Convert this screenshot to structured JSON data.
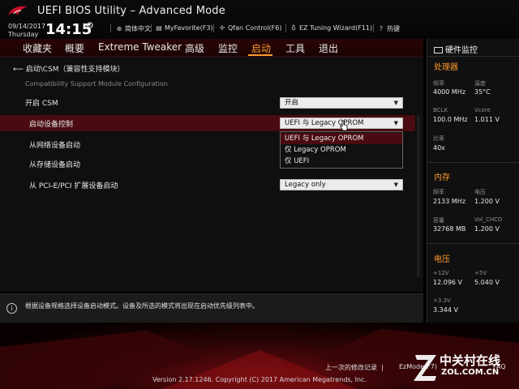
{
  "header": {
    "title": "UEFI BIOS Utility – Advanced Mode",
    "date": "09/14/2017",
    "weekday": "Thursday",
    "time": "14:15",
    "tools": [
      {
        "icon": "globe-icon",
        "label": "简体中文"
      },
      {
        "icon": "myfavorite-icon",
        "label": "MyFavorite(F3)"
      },
      {
        "icon": "fan-icon",
        "label": "Qfan Control(F6)"
      },
      {
        "icon": "bulb-icon",
        "label": "EZ Tuning Wizard(F11)"
      },
      {
        "icon": "hotkey-icon",
        "label": "热键"
      }
    ]
  },
  "menu": {
    "items": [
      "收藏夹",
      "概要",
      "Extreme Tweaker",
      "高级",
      "监控",
      "启动",
      "工具",
      "退出"
    ],
    "active": "启动"
  },
  "main": {
    "breadcrumb": "启动\\CSM（兼容性支持模块）",
    "subtitle": "Compatibility Support Module Configuration",
    "rows": [
      {
        "label": "开启 CSM",
        "value": "开启"
      },
      {
        "label": "启动设备控制",
        "value": "UEFI 与 Legacy OPROM"
      },
      {
        "label": "从网络设备启动",
        "value": ""
      },
      {
        "label": "从存储设备启动",
        "value": ""
      },
      {
        "label": "从 PCI-E/PCI 扩展设备启动",
        "value": "Legacy only"
      }
    ],
    "dropdown_options": [
      "UEFI 与 Legacy OPROM",
      "仅 Legacy OPROM",
      "仅 UEFI"
    ]
  },
  "info": {
    "text": "根据设备规格选择设备启动模式。设备及所选的模式将出现在启动优先级列表中。"
  },
  "hw_monitor": {
    "title": "硬件监控",
    "cpu": {
      "section": "处理器",
      "freq_label": "频率",
      "freq": "4000 MHz",
      "temp_label": "温度",
      "temp": "35°C",
      "bclk_label": "BCLK",
      "bclk": "100.0 MHz",
      "vcore_label": "Vcore",
      "vcore": "1.011 V",
      "ratio_label": "比率",
      "ratio": "40x"
    },
    "memory": {
      "section": "内存",
      "freq_label": "频率",
      "freq": "2133 MHz",
      "volt_label": "电压",
      "volt": "1.200 V",
      "cap_label": "容量",
      "cap": "32768 MB",
      "vchcd_label": "Vol_CHCD",
      "vchcd": "1.200 V"
    },
    "voltage": {
      "section": "电压",
      "v12_label": "+12V",
      "v12": "12.096 V",
      "v5_label": "+5V",
      "v5": "5.040 V",
      "v33_label": "+3.3V",
      "v33": "3.344 V"
    }
  },
  "footer": {
    "last_modified": "上一次的修改记录",
    "ezmode": "EzMode(F7)",
    "search_faq": "FAQ",
    "copyright": "Version 2.17.1246. Copyright (C) 2017 American Megatrends, Inc.",
    "watermark_main": "中关村在线",
    "watermark_sub": "ZOL.COM.CN"
  },
  "colors": {
    "accent": "#ff9a2e",
    "highlight_row": "#4a0b10",
    "menubar": "#2a0406"
  }
}
